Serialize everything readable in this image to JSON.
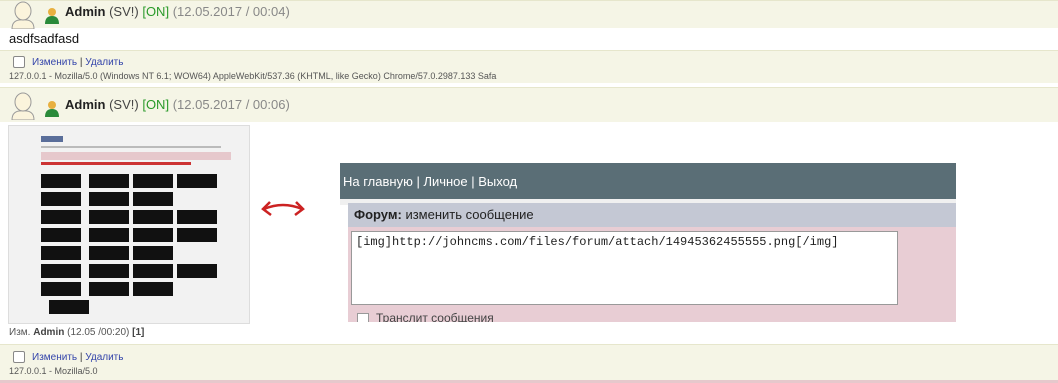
{
  "post1": {
    "author": "Admin",
    "role": "(SV!)",
    "online": "[ON]",
    "time": "(12.05.2017 / 00:04)",
    "text": "asdfsadfasd",
    "edit_label": "Изменить",
    "separator": "|",
    "delete_label": "Удалить",
    "user_agent": "127.0.0.1 - Mozilla/5.0 (Windows NT 6.1; WOW64) AppleWebKit/537.36 (KHTML, like Gecko) Chrome/57.0.2987.133 Safa"
  },
  "post2": {
    "author": "Admin",
    "role": "(SV!)",
    "online": "[ON]",
    "time": "(12.05.2017 / 00:06)",
    "embedded": {
      "nav": "На главную | Личное | Выход",
      "form_label": "Форум:",
      "form_action": "изменить сообщение",
      "textarea_value": "[img]http://johncms.com/files/forum/attach/14945362455555.png[/img]",
      "checkbox_label": "Транслит сообщения"
    },
    "edited_prefix": "Изм.",
    "edited_by": "Admin",
    "edited_time": "(12.05 /00:20)",
    "edited_count": "[1]",
    "edit_label": "Изменить",
    "separator": "|",
    "delete_label": "Удалить",
    "user_agent": "127.0.0.1 - Mozilla/5.0"
  },
  "colors": {
    "online": "#2a9a2a",
    "link": "#3344aa",
    "header_bg": "#f5f5e6",
    "nav_bg": "#5a6e76",
    "arrow": "#cc2222"
  },
  "icons": [
    "avatar-icon",
    "user-status-icon",
    "double-arrow-icon"
  ]
}
